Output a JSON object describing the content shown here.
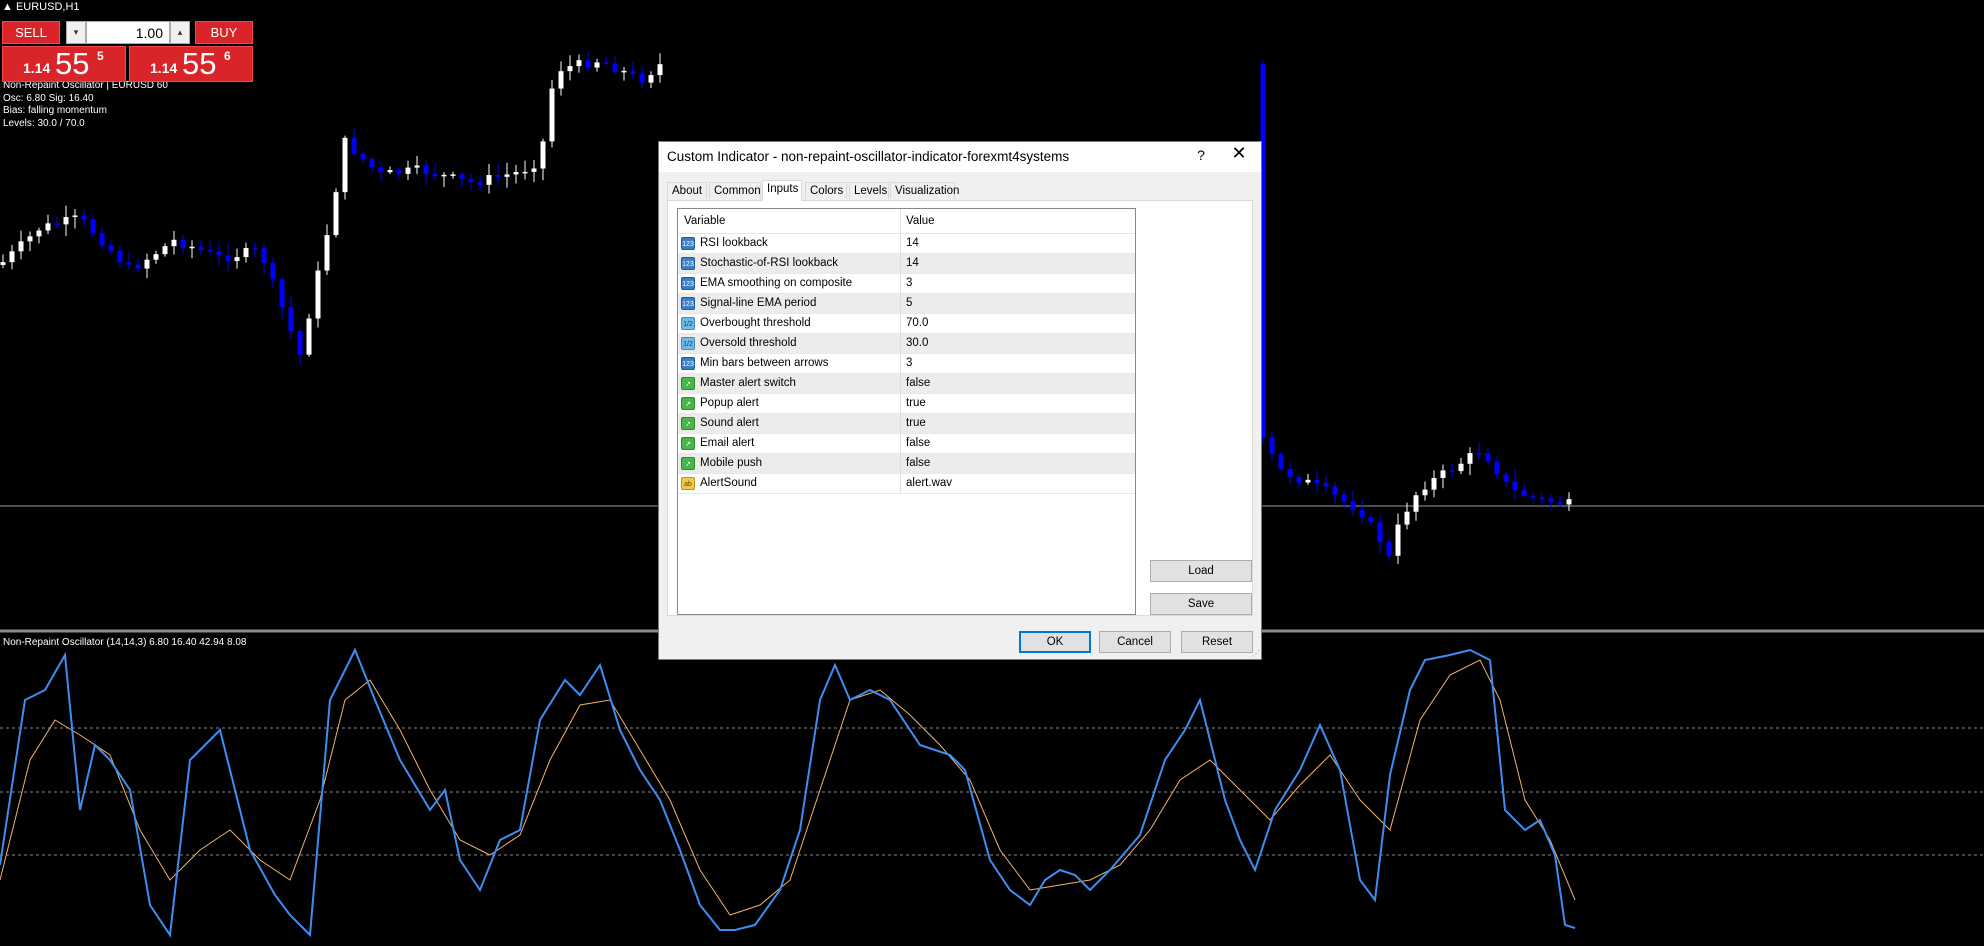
{
  "chart": {
    "symbol": "EURUSD,H1",
    "info_lines": [
      "Non-Repaint Oscillator | EURUSD 60",
      "Osc: 6.80  Sig: 16.40",
      "Bias: falling momentum",
      "Levels: 30.0 / 70.0"
    ],
    "oscillator_label": "Non-Repaint Oscillator (14,14,3) 6.80 16.40 42.94 8.08",
    "colors": {
      "bull": "#ffffff",
      "bear": "#0000ff",
      "osc_line": "#3d8ef0",
      "signal_line": "#f2b36b",
      "level_line": "#808080",
      "separator": "#808080"
    }
  },
  "trade_panel": {
    "sell_label": "SELL",
    "buy_label": "BUY",
    "lot": "1.00",
    "step_down": "▾",
    "step_up": "▴",
    "sell_price": {
      "small": "1.14",
      "big": "55",
      "sup": "5"
    },
    "buy_price": {
      "small": "1.14",
      "big": "55",
      "sup": "6"
    },
    "color": "#d9252a"
  },
  "dialog": {
    "title": "Custom Indicator - non-repaint-oscillator-indicator-forexmt4systems",
    "help_glyph": "?",
    "close_glyph": "✕",
    "tabs": [
      "About",
      "Common",
      "Inputs",
      "Colors",
      "Levels",
      "Visualization"
    ],
    "active_tab": "Inputs",
    "columns": {
      "variable": "Variable",
      "value": "Value"
    },
    "rows": [
      {
        "icon": "int-param-icon",
        "name": "RSI lookback",
        "value": "14"
      },
      {
        "icon": "int-param-icon",
        "name": "Stochastic-of-RSI lookback",
        "value": "14"
      },
      {
        "icon": "int-param-icon",
        "name": "EMA smoothing on composite",
        "value": "3"
      },
      {
        "icon": "int-param-icon",
        "name": "Signal-line EMA period",
        "value": "5"
      },
      {
        "icon": "double-param-icon",
        "name": "Overbought threshold",
        "value": "70.0"
      },
      {
        "icon": "double-param-icon",
        "name": "Oversold threshold",
        "value": "30.0"
      },
      {
        "icon": "int-param-icon",
        "name": "Min bars between arrows",
        "value": "3"
      },
      {
        "icon": "bool-param-icon",
        "name": "Master alert switch",
        "value": "false"
      },
      {
        "icon": "bool-param-icon",
        "name": "Popup alert",
        "value": "true"
      },
      {
        "icon": "bool-param-icon",
        "name": "Sound alert",
        "value": "true"
      },
      {
        "icon": "bool-param-icon",
        "name": "Email alert",
        "value": "false"
      },
      {
        "icon": "bool-param-icon",
        "name": "Mobile push",
        "value": "false"
      },
      {
        "icon": "string-param-icon",
        "name": "AlertSound",
        "value": "alert.wav"
      }
    ],
    "icon_glyphs": {
      "int-param-icon": "123",
      "double-param-icon": "1/2",
      "bool-param-icon": "↗",
      "string-param-icon": "ab"
    },
    "load_label": "Load",
    "save_label": "Save",
    "ok_label": "OK",
    "cancel_label": "Cancel",
    "reset_label": "Reset"
  }
}
